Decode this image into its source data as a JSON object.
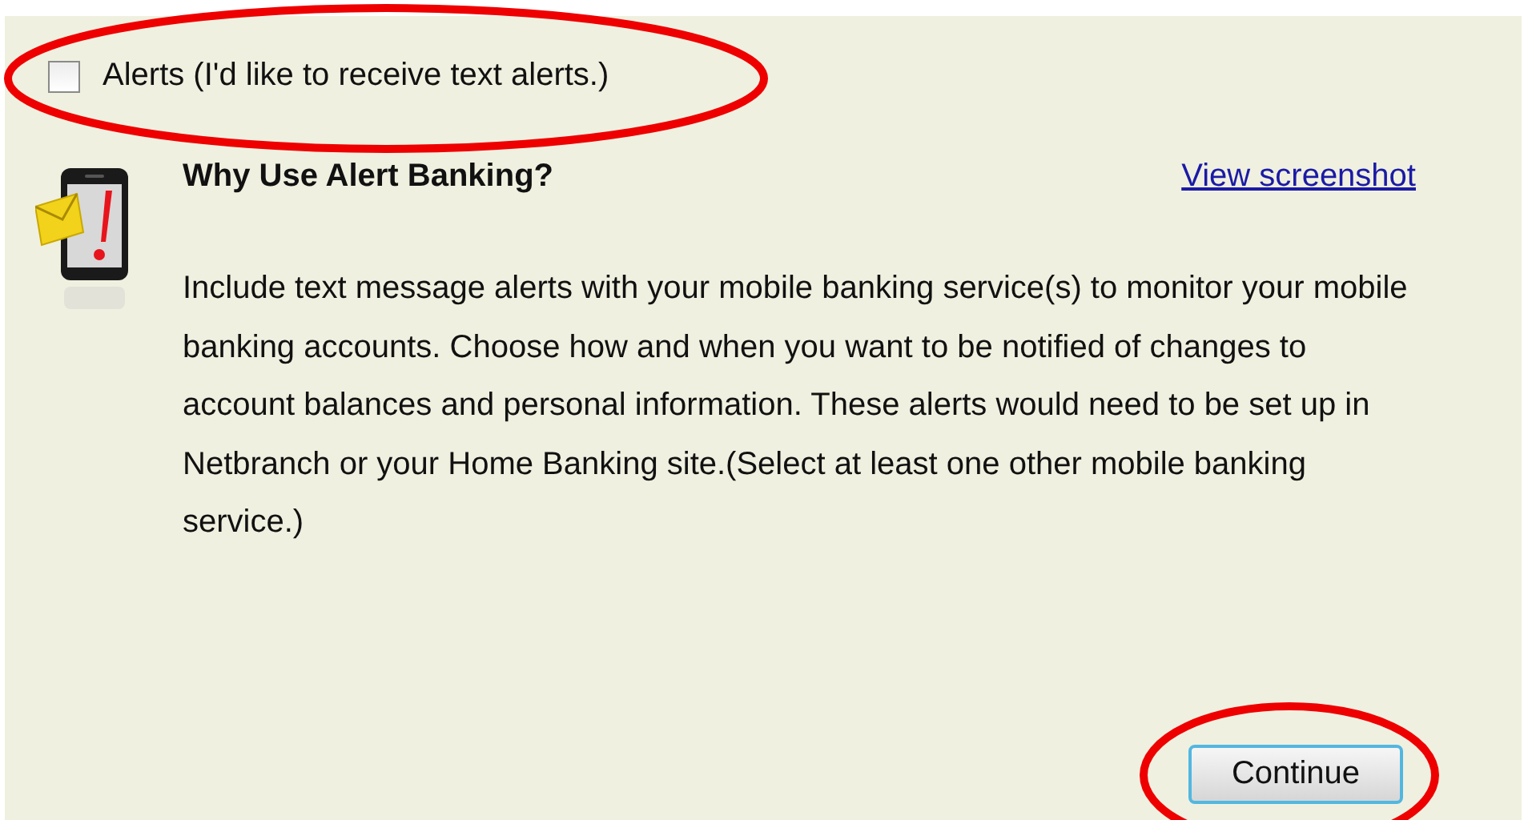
{
  "alerts_option": {
    "label": "Alerts (I'd like to receive text alerts.)",
    "checked": false
  },
  "info": {
    "title": "Why Use Alert Banking?",
    "link": "View screenshot",
    "body": "Include text message alerts with your mobile banking service(s) to monitor your mobile banking accounts. Choose how and when you want to be notified of changes to account balances and personal information. These alerts would need to be set up in Netbranch or your Home Banking site.(Select at least one other mobile banking service.)"
  },
  "buttons": [
    "Continue"
  ]
}
